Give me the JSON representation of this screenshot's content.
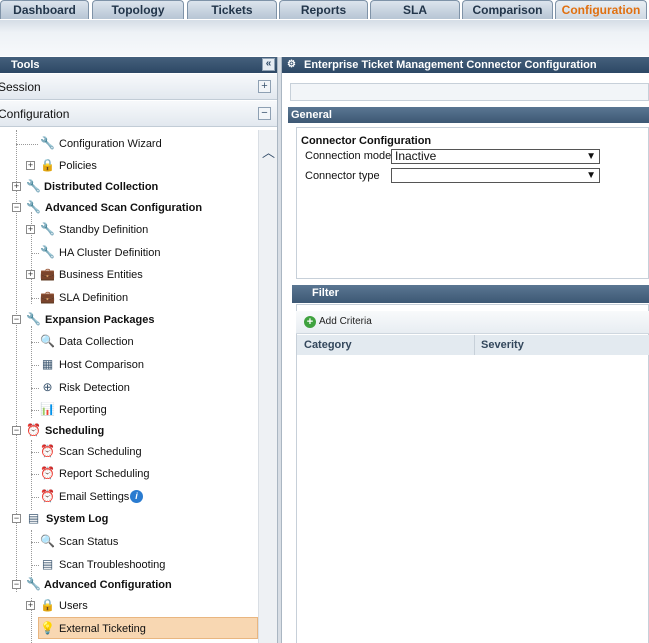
{
  "tabs": [
    {
      "label": "Dashboard",
      "active": false
    },
    {
      "label": "Topology",
      "active": false
    },
    {
      "label": "Tickets",
      "active": false
    },
    {
      "label": "Reports",
      "active": false
    },
    {
      "label": "SLA",
      "active": false
    },
    {
      "label": "Comparison",
      "active": false
    },
    {
      "label": "Configuration",
      "active": true
    }
  ],
  "left_panel": {
    "title": "Tools",
    "sections": [
      {
        "label": "Session",
        "toggle": "+"
      },
      {
        "label": "Configuration",
        "toggle": "−"
      }
    ],
    "tree": [
      {
        "label": "Configuration Wizard",
        "icon": "wrench-icon",
        "bold": false
      },
      {
        "label": "Policies",
        "icon": "lock-icon",
        "bold": false
      },
      {
        "label": "Distributed Collection",
        "icon": "wrench-icon",
        "bold": true
      },
      {
        "label": "Advanced Scan Configuration",
        "icon": "wrench-icon",
        "bold": true
      },
      {
        "label": "Standby Definition",
        "icon": "wrench-icon",
        "bold": false
      },
      {
        "label": "HA Cluster Definition",
        "icon": "wrench-icon",
        "bold": false
      },
      {
        "label": "Business Entities",
        "icon": "briefcase-icon",
        "bold": false
      },
      {
        "label": "SLA Definition",
        "icon": "briefcase-icon",
        "bold": false
      },
      {
        "label": "Expansion Packages",
        "icon": "wrench-icon",
        "bold": true
      },
      {
        "label": "Data Collection",
        "icon": "magnifier-icon",
        "bold": false
      },
      {
        "label": "Host Comparison",
        "icon": "compare-icon",
        "bold": false
      },
      {
        "label": "Risk Detection",
        "icon": "target-icon",
        "bold": false
      },
      {
        "label": "Reporting",
        "icon": "bar-chart-icon",
        "bold": false
      },
      {
        "label": "Scheduling",
        "icon": "clock-icon",
        "bold": true
      },
      {
        "label": "Scan Scheduling",
        "icon": "clock-icon",
        "bold": false
      },
      {
        "label": "Report Scheduling",
        "icon": "clock-icon",
        "bold": false
      },
      {
        "label": "Email Settings",
        "icon": "clock-icon",
        "bold": false
      },
      {
        "label": "System Log",
        "icon": "log-icon",
        "bold": true
      },
      {
        "label": "Scan Status",
        "icon": "magnifier-icon",
        "bold": false
      },
      {
        "label": "Scan Troubleshooting",
        "icon": "log-icon",
        "bold": false
      },
      {
        "label": "Advanced Configuration",
        "icon": "wrench-icon",
        "bold": true
      },
      {
        "label": "Users",
        "icon": "lock-icon",
        "bold": false
      },
      {
        "label": "External Ticketing",
        "icon": "bulb-icon",
        "bold": false,
        "selected": true
      }
    ]
  },
  "right_panel": {
    "title": "Enterprise Ticket Management Connector Configuration",
    "general_label": "General",
    "connector_config_label": "Connector Configuration",
    "connection_mode_label": "Connection mode",
    "connection_mode_value": "Inactive",
    "connector_type_label": "Connector type",
    "connector_type_value": "",
    "filter_label": "Filter",
    "add_criteria_label": "Add Criteria",
    "columns": [
      "Category",
      "Severity"
    ]
  },
  "colors": {
    "header_dark": "#2d4865",
    "active_tab_text": "#e07010",
    "selected_row": "#f8d7b2",
    "add_icon": "#3fa23f"
  }
}
